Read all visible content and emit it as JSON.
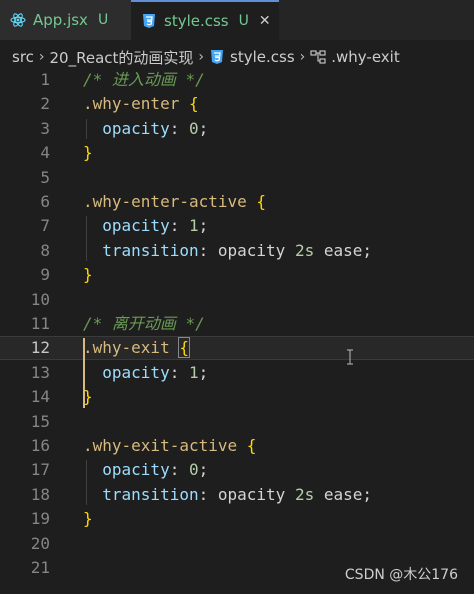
{
  "tabs": [
    {
      "label": "App.jsx",
      "status": "U",
      "icon": "react-icon",
      "active": false
    },
    {
      "label": "style.css",
      "status": "U",
      "icon": "css-icon",
      "active": true,
      "close": "✕"
    }
  ],
  "breadcrumb": {
    "root": "src",
    "folder": "20_React的动画实现",
    "file": "style.css",
    "symbol": ".why-exit",
    "separator": "›"
  },
  "editor": {
    "current_line": 12,
    "lines": [
      {
        "n": "1",
        "text": "/* 进入动画 */"
      },
      {
        "n": "2",
        "text": ".why-enter {"
      },
      {
        "n": "3",
        "text": "  opacity: 0;"
      },
      {
        "n": "4",
        "text": "}"
      },
      {
        "n": "5",
        "text": ""
      },
      {
        "n": "6",
        "text": ".why-enter-active {"
      },
      {
        "n": "7",
        "text": "  opacity: 1;"
      },
      {
        "n": "8",
        "text": "  transition: opacity 2s ease;"
      },
      {
        "n": "9",
        "text": "}"
      },
      {
        "n": "10",
        "text": ""
      },
      {
        "n": "11",
        "text": "/* 离开动画 */"
      },
      {
        "n": "12",
        "text": ".why-exit {"
      },
      {
        "n": "13",
        "text": "  opacity: 1;"
      },
      {
        "n": "14",
        "text": "}"
      },
      {
        "n": "15",
        "text": ""
      },
      {
        "n": "16",
        "text": ".why-exit-active {"
      },
      {
        "n": "17",
        "text": "  opacity: 0;"
      },
      {
        "n": "18",
        "text": "  transition: opacity 2s ease;"
      },
      {
        "n": "19",
        "text": "}"
      },
      {
        "n": "20",
        "text": ""
      },
      {
        "n": "21",
        "text": ""
      }
    ]
  },
  "watermark": "CSDN @木公176",
  "colors": {
    "selector": "#d7ba7d",
    "brace": "#ffd700",
    "property": "#9cdcfe",
    "number": "#b5cea8",
    "comment": "#6a9955",
    "untracked": "#73c991",
    "active_tab_border": "#5f8fd6"
  }
}
